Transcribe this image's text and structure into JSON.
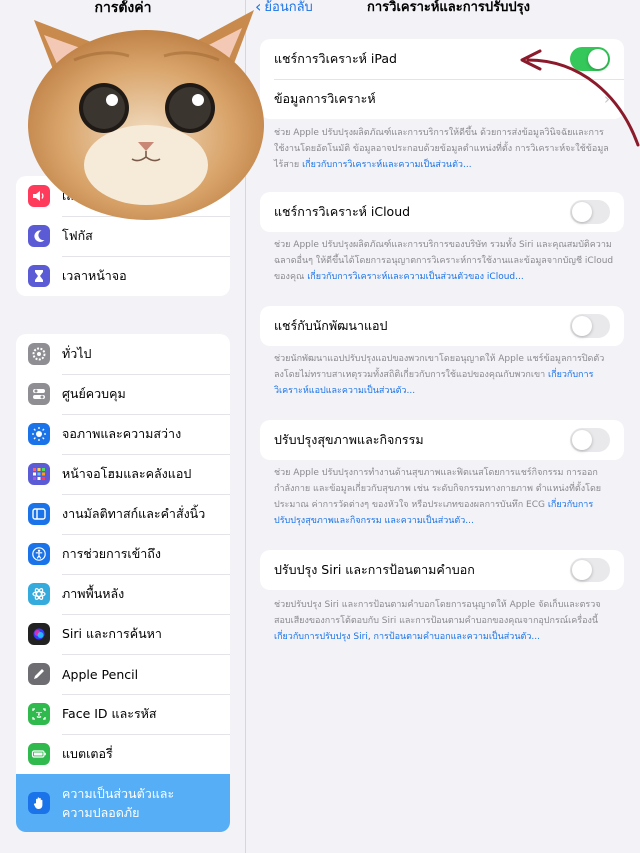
{
  "sidebar": {
    "title": "การตั้งค่า",
    "group1": [
      {
        "label": "เสียง",
        "icon": "speaker-icon",
        "color": "#ff3b5c"
      },
      {
        "label": "โฟกัส",
        "icon": "moon-icon",
        "color": "#5b5bd6"
      },
      {
        "label": "เวลาหน้าจอ",
        "icon": "hourglass-icon",
        "color": "#5b5bd6"
      }
    ],
    "group2": [
      {
        "label": "ทั่วไป",
        "icon": "gear-icon",
        "color": "#8e8e93"
      },
      {
        "label": "ศูนย์ควบคุม",
        "icon": "switches-icon",
        "color": "#8e8e93"
      },
      {
        "label": "จอภาพและความสว่าง",
        "icon": "sun-icon",
        "color": "#1a73e8"
      },
      {
        "label": "หน้าจอโฮมและคลังแอป",
        "icon": "app-grid-icon",
        "color": "#5b5bd6"
      },
      {
        "label": "งานมัลติทาสก์และคำสั่งนิ้ว",
        "icon": "multitask-icon",
        "color": "#1a73e8"
      },
      {
        "label": "การช่วยการเข้าถึง",
        "icon": "accessibility-icon",
        "color": "#1a73e8"
      },
      {
        "label": "ภาพพื้นหลัง",
        "icon": "wallpaper-icon",
        "color": "#35aadc"
      },
      {
        "label": "Siri และการค้นหา",
        "icon": "siri-icon",
        "color": "#222222"
      },
      {
        "label": "Apple Pencil",
        "icon": "pencil-icon",
        "color": "#6d6d72"
      },
      {
        "label": "Face ID และรหัส",
        "icon": "face-id-icon",
        "color": "#30b94d"
      },
      {
        "label": "แบตเตอรี่",
        "icon": "battery-icon",
        "color": "#30b94d"
      },
      {
        "label": "ความเป็นส่วนตัวและความปลอดภัย",
        "icon": "hand-icon",
        "color": "#1a73e8"
      }
    ]
  },
  "nav": {
    "back_label": "ย้อนกลับ",
    "title": "การวิเคราะห์และการปรับปรุง"
  },
  "sections": [
    {
      "rows": [
        {
          "label": "แชร์การวิเคราะห์ iPad",
          "control": "toggle",
          "on": true
        },
        {
          "label": "ข้อมูลการวิเคราะห์",
          "control": "chevron"
        }
      ],
      "footnote": "ช่วย Apple ปรับปรุงผลิตภัณฑ์และการบริการให้ดีขึ้น ด้วยการส่งข้อมูลวินิจฉัยและการใช้งานโดยอัตโนมัติ ข้อมูลอาจประกอบด้วยข้อมูลตำแหน่งที่ตั้ง การวิเคราะห์จะใช้ข้อมูลไร้สาย",
      "link": "เกี่ยวกับการวิเคราะห์และความเป็นส่วนตัว..."
    },
    {
      "rows": [
        {
          "label": "แชร์การวิเคราะห์ iCloud",
          "control": "toggle",
          "on": false
        }
      ],
      "footnote": "ช่วย Apple ปรับปรุงผลิตภัณฑ์และการบริการของบริษัท รวมทั้ง Siri และคุณสมบัติความฉลาดอื่นๆ ให้ดีขึ้นได้โดยการอนุญาตการวิเคราะห์การใช้งานและข้อมูลจากบัญชี iCloud ของคุณ",
      "link": "เกี่ยวกับการวิเคราะห์และความเป็นส่วนตัวของ iCloud..."
    },
    {
      "rows": [
        {
          "label": "แชร์กับนักพัฒนาแอป",
          "control": "toggle",
          "on": false
        }
      ],
      "footnote": "ช่วยนักพัฒนาแอปปรับปรุงแอปของพวกเขาโดยอนุญาตให้ Apple แชร์ข้อมูลการปิดตัวลงโดยไม่ทราบสาเหตุรวมทั้งสถิติเกี่ยวกับการใช้แอปของคุณกับพวกเขา",
      "link": "เกี่ยวกับการวิเคราะห์แอปและความเป็นส่วนตัว..."
    },
    {
      "rows": [
        {
          "label": "ปรับปรุงสุขภาพและกิจกรรม",
          "control": "toggle",
          "on": false
        }
      ],
      "footnote": "ช่วย Apple ปรับปรุงการทำงานด้านสุขภาพและฟิตเนสโดยการแชร์กิจกรรม การออกกำลังกาย และข้อมูลเกี่ยวกับสุขภาพ เช่น ระดับกิจกรรมทางกายภาพ ตำแหน่งที่ตั้งโดยประมาณ ค่าการวัดต่างๆ ของหัวใจ หรือประเภทของผลการบันทึก ECG",
      "link": "เกี่ยวกับการปรับปรุงสุขภาพและกิจกรรม และความเป็นส่วนตัว..."
    },
    {
      "rows": [
        {
          "label": "ปรับปรุง Siri และการป้อนตามคำบอก",
          "control": "toggle",
          "on": false
        }
      ],
      "footnote": "ช่วยปรับปรุง Siri และการป้อนตามคำบอกโดยการอนุญาตให้ Apple จัดเก็บและตรวจสอบเสียงของการโต้ตอบกับ Siri และการป้อนตามคำบอกของคุณจากอุปกรณ์เครื่องนี้",
      "link": "เกี่ยวกับการปรับปรุง Siri, การป้อนตามคำบอกและความเป็นส่วนตัว..."
    }
  ]
}
